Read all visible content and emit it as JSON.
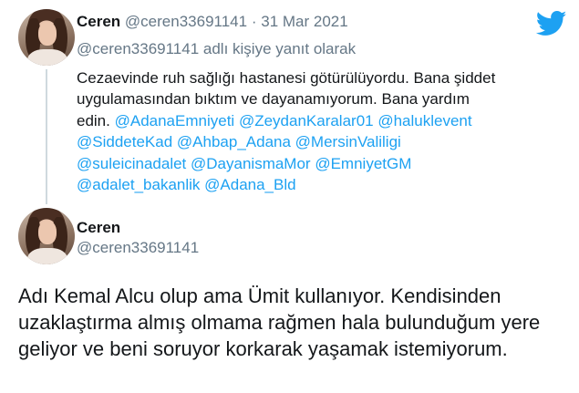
{
  "tweet1": {
    "name": "Ceren",
    "handle": "@ceren33691141",
    "separator": "·",
    "date": "31 Mar 2021",
    "reply_to": "@ceren33691141 adlı kişiye yanıt olarak",
    "text_parts": [
      {
        "text": "Cezaevinde ruh sağlığı hastanesi götürülüyordu. Bana şiddet uygulamasından bıktım ve dayanamıyorum. Bana yardım edin. ",
        "mention": false
      },
      {
        "text": "@AdanaEmniyeti",
        "mention": true
      },
      {
        "text": " ",
        "mention": false
      },
      {
        "text": "@ZeydanKaralar01",
        "mention": true
      },
      {
        "text": " ",
        "mention": false
      },
      {
        "text": "@haluklevent",
        "mention": true
      },
      {
        "text": " ",
        "mention": false
      },
      {
        "text": "@SiddeteKad",
        "mention": true
      },
      {
        "text": " ",
        "mention": false
      },
      {
        "text": "@Ahbap_Adana",
        "mention": true
      },
      {
        "text": " ",
        "mention": false
      },
      {
        "text": "@MersinValiligi",
        "mention": true
      },
      {
        "text": " ",
        "mention": false
      },
      {
        "text": "@suleicinadalet",
        "mention": true
      },
      {
        "text": " ",
        "mention": false
      },
      {
        "text": "@DayanismaMor",
        "mention": true
      },
      {
        "text": " ",
        "mention": false
      },
      {
        "text": "@EmniyetGM",
        "mention": true
      },
      {
        "text": " ",
        "mention": false
      },
      {
        "text": "@adalet_bakanlik",
        "mention": true
      },
      {
        "text": " ",
        "mention": false
      },
      {
        "text": "@Adana_Bld",
        "mention": true
      }
    ]
  },
  "tweet2": {
    "name": "Ceren",
    "handle": "@ceren33691141",
    "text": "Adı Kemal Alcu olup ama Ümit kullanıyor. Kendisinden uzaklaştırma almış olmama rağmen hala bulunduğum yere geliyor ve beni soruyor korkarak yaşamak istemiyorum."
  },
  "icons": {
    "logo": "twitter-bird-icon",
    "brand_color": "#1da1f2",
    "muted_color": "#657786"
  }
}
